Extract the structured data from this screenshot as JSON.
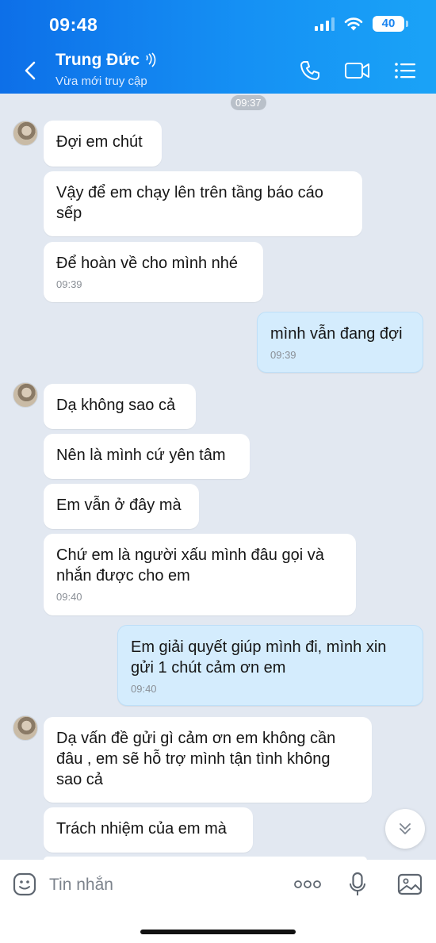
{
  "status_bar": {
    "time": "09:48",
    "battery": "40"
  },
  "header": {
    "contact_name": "Trung Đức",
    "contact_status": "Vừa mới truy cập"
  },
  "chat": {
    "time_separator": "09:37",
    "messages": [
      {
        "dir": "in",
        "text": "Đợi em chút",
        "time": ""
      },
      {
        "dir": "in",
        "text": "Vậy để em chạy lên trên tầng báo cáo\nsếp",
        "time": ""
      },
      {
        "dir": "in",
        "text": "Để hoàn về cho mình nhé",
        "time": "09:39"
      },
      {
        "dir": "out",
        "text": "mình vẫn đang đợi",
        "time": "09:39"
      },
      {
        "dir": "in",
        "text": "Dạ không sao cả",
        "time": ""
      },
      {
        "dir": "in",
        "text": "Nên là mình cứ yên tâm",
        "time": ""
      },
      {
        "dir": "in",
        "text": "Em vẫn ở đây mà",
        "time": ""
      },
      {
        "dir": "in",
        "text": "Chứ em là người xấu mình đâu gọi và\nnhắn được cho em",
        "time": "09:40"
      },
      {
        "dir": "out",
        "text": "Em giải quyết giúp mình đi, mình xin\ngửi 1 chút cảm ơn em",
        "time": "09:40"
      },
      {
        "dir": "in",
        "text": "Dạ vấn đề gửi gì cảm ơn em không cần\nđâu , em sẽ hỗ trợ mình tận tình không\nsao cả",
        "time": ""
      },
      {
        "dir": "in",
        "text": "Trách nhiệm của em mà",
        "time": ""
      }
    ]
  },
  "input_bar": {
    "placeholder": "Tin nhắn"
  },
  "icons": {
    "back": "chevron-left-icon",
    "voice_call": "phone-icon",
    "video_call": "video-camera-icon",
    "menu": "list-menu-icon",
    "emoji": "emoji-sticker-icon",
    "more": "more-dots-icon",
    "voice_message": "microphone-icon",
    "photo": "image-icon",
    "scroll_down": "double-chevron-down-icon"
  },
  "colors": {
    "header_start": "#0d6fe8",
    "header_end": "#1aa3f7",
    "chat_bg": "#e2e8f1",
    "outgoing_bubble": "#d4ecfd",
    "incoming_bubble": "#ffffff"
  }
}
